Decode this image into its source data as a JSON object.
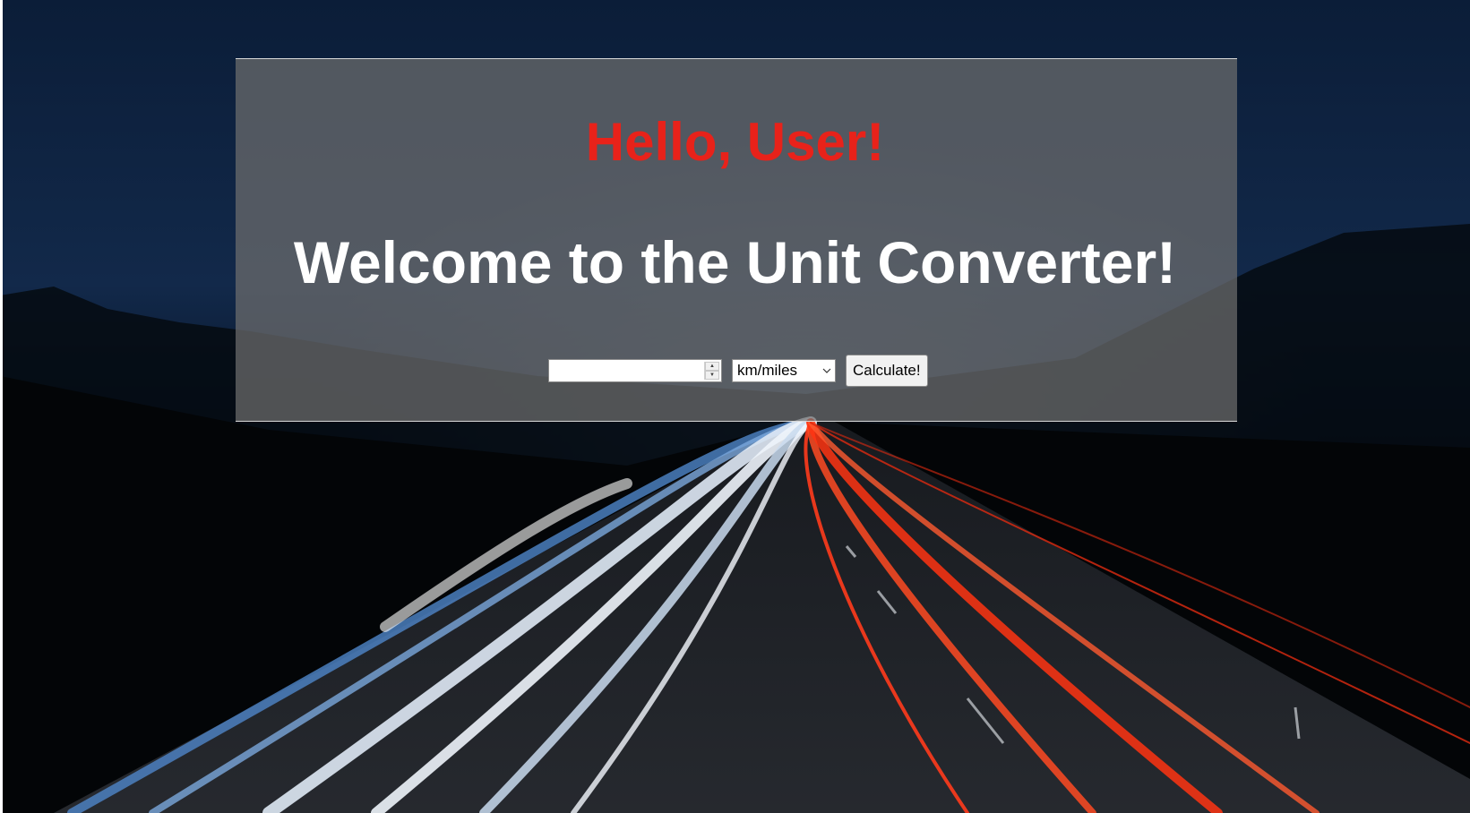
{
  "background": {
    "image": "night-highway-light-trails",
    "colors": {
      "sky": "#0e2444",
      "trail_white": "#dfe9f5",
      "trail_blue": "#4f86c9",
      "trail_red": "#ff3b1c"
    }
  },
  "panel": {
    "greeting": "Hello, User!",
    "greeting_color": "#e8221a",
    "title": "Welcome to the Unit Converter!"
  },
  "form": {
    "number_value": "",
    "unit_options_selected": "km/miles",
    "calculate_label": "Calculate!",
    "spin_up_icon": "triangle-up",
    "spin_down_icon": "triangle-down",
    "select_icon": "chevron-down"
  }
}
